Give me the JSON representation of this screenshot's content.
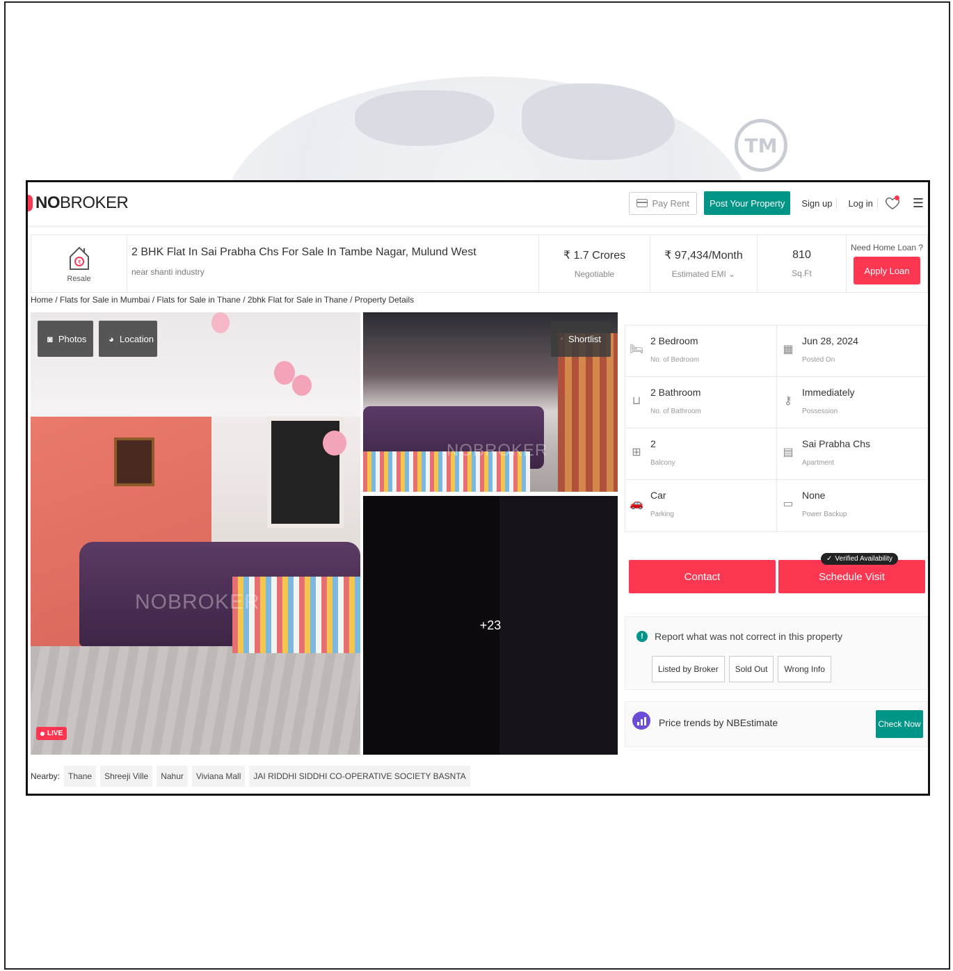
{
  "header": {
    "logo_bold": "NO",
    "logo_rest": "BROKER",
    "nav": {
      "pay_rent": "Pay Rent",
      "post_property": "Post Your Property",
      "sign_up": "Sign up",
      "log_in": "Log in"
    }
  },
  "summary": {
    "badge": "Resale",
    "title": "2 BHK Flat In Sai Prabha Chs For Sale In Tambe Nagar, Mulund West",
    "subtitle": "near shanti industry",
    "price": {
      "value": "₹ 1.7 Crores",
      "label": "Negotiable"
    },
    "emi": {
      "value": "₹ 97,434/Month",
      "label": "Estimated EMI"
    },
    "area": {
      "value": "810",
      "label": "Sq.Ft"
    },
    "loan": {
      "question": "Need Home Loan ?",
      "button": "Apply Loan"
    }
  },
  "breadcrumb": "Home / Flats for Sale in Mumbai / Flats for Sale in Thane / 2bhk Flat for Sale in Thane / Property Details",
  "gallery": {
    "photos_label": "Photos",
    "location_label": "Location",
    "shortlist_label": "Shortlist",
    "more_count": "+23",
    "live_label": "LIVE",
    "watermark": "NOBROKER"
  },
  "nearby": {
    "label": "Nearby:",
    "items": [
      "Thane",
      "Shreeji Ville",
      "Nahur",
      "Viviana Mall",
      "JAI RIDDHI SIDDHI CO-OPERATIVE SOCIETY BASNTA"
    ]
  },
  "details": [
    [
      {
        "value": "2 Bedroom",
        "label": "No. of Bedroom",
        "icon": "bed-icon"
      },
      {
        "value": "Jun 28, 2024",
        "label": "Posted On",
        "icon": "calendar-icon"
      }
    ],
    [
      {
        "value": "2 Bathroom",
        "label": "No. of Bathroom",
        "icon": "bathtub-icon"
      },
      {
        "value": "Immediately",
        "label": "Possession",
        "icon": "key-icon"
      }
    ],
    [
      {
        "value": "2",
        "label": "Balcony",
        "icon": "balcony-icon"
      },
      {
        "value": "Sai Prabha Chs",
        "label": "Apartment",
        "icon": "building-icon"
      }
    ],
    [
      {
        "value": "Car",
        "label": "Parking",
        "icon": "car-icon"
      },
      {
        "value": "None",
        "label": "Power Backup",
        "icon": "battery-icon"
      }
    ]
  ],
  "actions": {
    "contact": "Contact",
    "schedule": "Schedule Visit",
    "verified": "Verified Availability"
  },
  "report": {
    "heading": "Report what was not correct in this property",
    "options": [
      "Listed by Broker",
      "Sold Out",
      "Wrong Info"
    ]
  },
  "trends": {
    "text": "Price trends by NBEstimate",
    "button": "Check Now"
  },
  "colors": {
    "brand_red": "#fd3752",
    "brand_teal": "#009587"
  }
}
